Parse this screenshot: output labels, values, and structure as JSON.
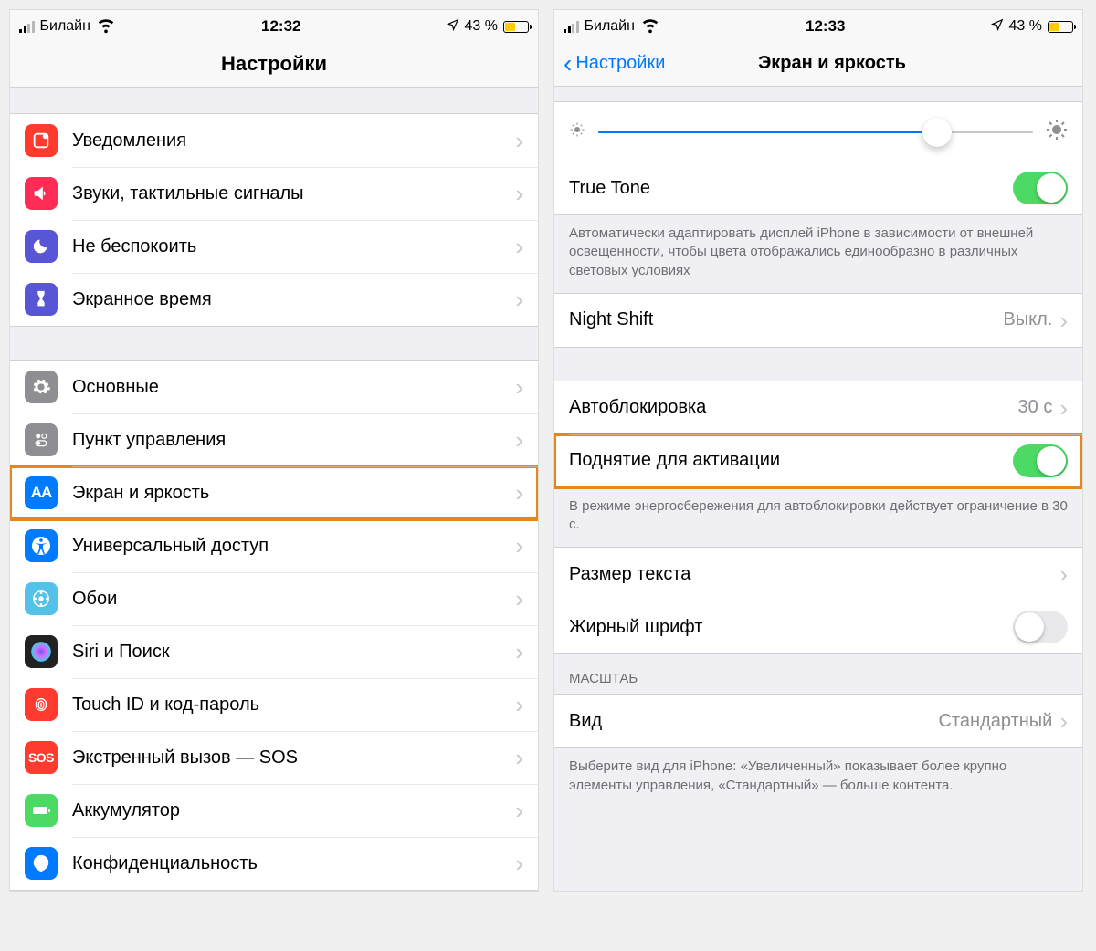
{
  "left": {
    "status": {
      "carrier": "Билайн",
      "time": "12:32",
      "battery_text": "43 %",
      "battery_level": 43
    },
    "title": "Настройки",
    "groups": [
      [
        {
          "label": "Уведомления",
          "icon": "notifications-icon",
          "bg": "#ff3b30"
        },
        {
          "label": "Звуки, тактильные сигналы",
          "icon": "sounds-icon",
          "bg": "#ff2d55"
        },
        {
          "label": "Не беспокоить",
          "icon": "do-not-disturb-icon",
          "bg": "#5856d6"
        },
        {
          "label": "Экранное время",
          "icon": "screen-time-icon",
          "bg": "#5856d6"
        }
      ],
      [
        {
          "label": "Основные",
          "icon": "general-icon",
          "bg": "#8e8e93"
        },
        {
          "label": "Пункт управления",
          "icon": "control-center-icon",
          "bg": "#8e8e93"
        },
        {
          "label": "Экран и яркость",
          "icon": "display-brightness-icon",
          "bg": "#007aff",
          "highlight": true
        },
        {
          "label": "Универсальный доступ",
          "icon": "accessibility-icon",
          "bg": "#007aff"
        },
        {
          "label": "Обои",
          "icon": "wallpaper-icon",
          "bg": "#55c1e8"
        },
        {
          "label": "Siri и Поиск",
          "icon": "siri-icon",
          "bg": "#222"
        },
        {
          "label": "Touch ID и код-пароль",
          "icon": "touch-id-icon",
          "bg": "#ff3b30"
        },
        {
          "label": "Экстренный вызов — SOS",
          "icon": "sos-icon",
          "bg": "#ff3b30"
        },
        {
          "label": "Аккумулятор",
          "icon": "battery-icon",
          "bg": "#4cd964"
        },
        {
          "label": "Конфиденциальность",
          "icon": "privacy-icon",
          "bg": "#007aff"
        }
      ]
    ]
  },
  "right": {
    "status": {
      "carrier": "Билайн",
      "time": "12:33",
      "battery_text": "43 %",
      "battery_level": 43
    },
    "back": "Настройки",
    "title": "Экран и яркость",
    "brightness_percent": 78,
    "true_tone": {
      "label": "True Tone",
      "on": true
    },
    "true_tone_footer": "Автоматически адаптировать дисплей iPhone в зависимости от внешней освещенности, чтобы цвета отображались единообразно в различных световых условиях",
    "night_shift": {
      "label": "Night Shift",
      "value": "Выкл."
    },
    "auto_lock": {
      "label": "Автоблокировка",
      "value": "30 с"
    },
    "raise_to_wake": {
      "label": "Поднятие для активации",
      "on": true,
      "highlight": true
    },
    "power_footer": "В режиме энергосбережения для автоблокировки действует ограничение в 30 с.",
    "text_size": {
      "label": "Размер текста"
    },
    "bold_text": {
      "label": "Жирный шрифт",
      "on": false
    },
    "zoom_header": "МАСШТАБ",
    "zoom_view": {
      "label": "Вид",
      "value": "Стандартный"
    },
    "zoom_footer": "Выберите вид для iPhone: «Увеличенный» показывает более крупно элементы управления, «Стандартный» — больше контента."
  }
}
